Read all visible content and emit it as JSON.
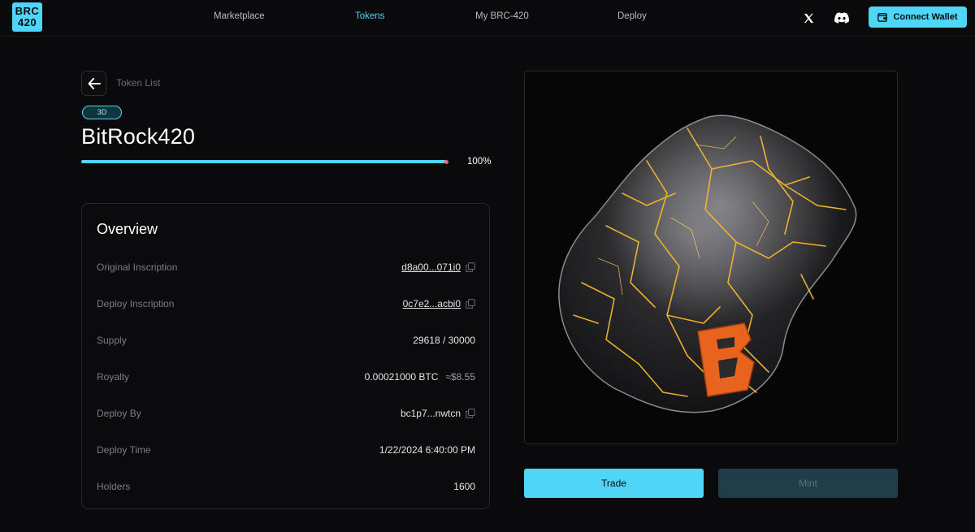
{
  "header": {
    "logo_line1": "BRC",
    "logo_line2": "420",
    "nav": [
      {
        "label": "Marketplace",
        "active": false
      },
      {
        "label": "Tokens",
        "active": true
      },
      {
        "label": "My BRC-420",
        "active": false
      },
      {
        "label": "Deploy",
        "active": false
      }
    ],
    "social_icons": [
      "x-icon",
      "discord-icon"
    ],
    "connect_wallet_label": "Connect Wallet"
  },
  "breadcrumb": "Token List",
  "badge": "3D",
  "token_name": "BitRock420",
  "progress": {
    "percent_value": 100,
    "label": "100%"
  },
  "overview": {
    "title": "Overview",
    "original_inscription": {
      "label": "Original Inscription",
      "value": "d8a00...071i0"
    },
    "deploy_inscription": {
      "label": "Deploy Inscription",
      "value": "0c7e2...acbi0"
    },
    "supply": {
      "label": "Supply",
      "value": "29618 / 30000"
    },
    "royalty": {
      "label": "Royalty",
      "value": "0.00021000 BTC",
      "usd": "≈$8.55"
    },
    "deploy_by": {
      "label": "Deploy By",
      "value": "bc1p7...nwtcn"
    },
    "deploy_time": {
      "label": "Deploy Time",
      "value": "1/22/2024 6:40:00 PM"
    },
    "holders": {
      "label": "Holders",
      "value": "1600"
    }
  },
  "actions": {
    "trade_label": "Trade",
    "mint_label": "Mint"
  },
  "colors": {
    "accent": "#4fd6f7",
    "background": "#0a0a0c",
    "mint_disabled": "#203e47",
    "progress_end": "#ff5c6c",
    "rock_vein": "#f2b72c",
    "rock_logo": "#e8641e"
  }
}
